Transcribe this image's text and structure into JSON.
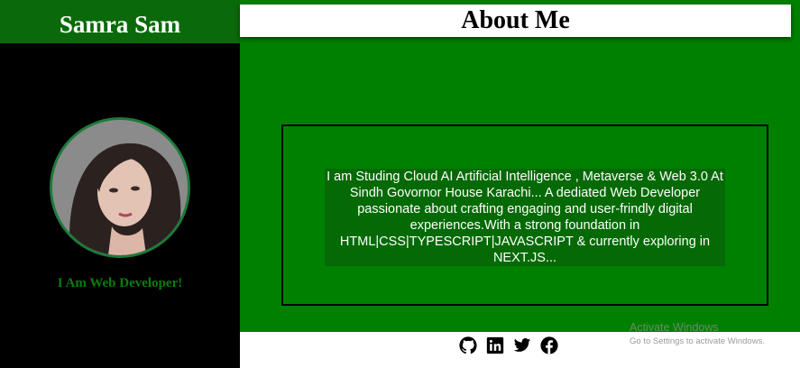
{
  "sidebar": {
    "name": "Samra Sam",
    "tagline": "I Am Web Developer!"
  },
  "main": {
    "title": "About Me",
    "about": "I am Studing Cloud AI Artificial Intelligence , Metaverse & Web 3.0 At Sindh Govornor House Karachi... A dediated Web Developer passionate about crafting engaging and user-frindly digital experiences.With a strong foundation in HTML|CSS|TYPESCRIPT|JAVASCRIPT & currently exploring in NEXT.JS..."
  },
  "footer": {
    "social_icons": [
      "github-icon",
      "linkedin-icon",
      "twitter-icon",
      "facebook-icon"
    ]
  },
  "watermark": {
    "title": "Activate Windows",
    "subtitle": "Go to Settings to activate Windows."
  },
  "colors": {
    "accent_green": "#008000",
    "header_green": "#0a6a0a",
    "tagline_green": "#0a7d0a"
  }
}
